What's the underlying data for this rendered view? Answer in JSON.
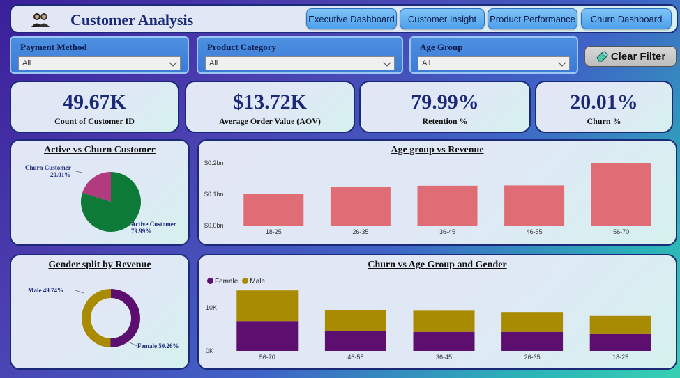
{
  "header": {
    "title": "Customer Analysis",
    "nav": [
      "Executive Dashboard",
      "Customer Insight",
      "Product Performance",
      "Churn Dashboard"
    ]
  },
  "filters": [
    {
      "label": "Payment Method",
      "value": "All"
    },
    {
      "label": "Product Category",
      "value": "All"
    },
    {
      "label": "Age Group",
      "value": "All"
    }
  ],
  "clear_filter_label": "Clear Filter",
  "kpis": [
    {
      "value": "49.67K",
      "label": "Count of Customer ID"
    },
    {
      "value": "$13.72K",
      "label": "Average Order Value (AOV)"
    },
    {
      "value": "79.99%",
      "label": "Retention %"
    },
    {
      "value": "20.01%",
      "label": "Churn %"
    }
  ],
  "colors": {
    "active": "#0e7a38",
    "churn": "#b23a7e",
    "bar": "#e06c75",
    "female": "#5c0f6e",
    "male": "#a88b00",
    "title": "#1b2a78"
  },
  "chart_data": [
    {
      "type": "pie",
      "title": "Active vs Churn Customer",
      "labels": [
        "Active Customer",
        "Churn Customer"
      ],
      "values": [
        79.99,
        20.01
      ],
      "data_labels": [
        "79.99%",
        "20.01%"
      ]
    },
    {
      "type": "bar",
      "title": "Age group vs Revenue",
      "categories": [
        "18-25",
        "26-35",
        "36-45",
        "46-55",
        "56-70"
      ],
      "values": [
        0.1,
        0.124,
        0.127,
        0.128,
        0.2
      ],
      "ytick_labels": [
        "$0.0bn",
        "$0.1bn",
        "$0.2bn"
      ],
      "yticks": [
        0,
        0.1,
        0.2
      ],
      "ylim": [
        0,
        0.2
      ]
    },
    {
      "type": "pie",
      "title": "Gender split by Revenue",
      "labels": [
        "Male",
        "Female"
      ],
      "values": [
        49.74,
        50.26
      ],
      "data_labels": [
        "49.74%",
        "50.26%"
      ]
    },
    {
      "type": "bar",
      "title": "Churn vs Age Group and Gender",
      "categories": [
        "56-70",
        "46-55",
        "36-45",
        "26-35",
        "18-25"
      ],
      "series": [
        {
          "name": "Female",
          "values": [
            6900,
            4600,
            4400,
            4400,
            3900
          ]
        },
        {
          "name": "Male",
          "values": [
            7100,
            4900,
            4900,
            4600,
            4200
          ]
        }
      ],
      "yticks": [
        0,
        10000
      ],
      "ytick_labels": [
        "0K",
        "10K"
      ],
      "ylim": [
        0,
        15000
      ]
    }
  ]
}
